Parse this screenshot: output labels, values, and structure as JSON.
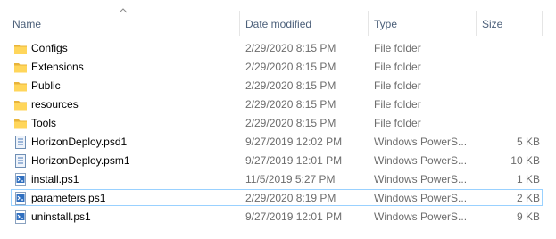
{
  "columns": {
    "name": "Name",
    "date_modified": "Date modified",
    "type": "Type",
    "size": "Size"
  },
  "sort": {
    "column": "name",
    "direction": "ascending",
    "icon": "sort-up-caret-icon"
  },
  "files": [
    {
      "name": "Configs",
      "date": "2/29/2020 8:15 PM",
      "type": "File folder",
      "size": "",
      "icon": "folder-icon",
      "selected": false
    },
    {
      "name": "Extensions",
      "date": "2/29/2020 8:15 PM",
      "type": "File folder",
      "size": "",
      "icon": "folder-icon",
      "selected": false
    },
    {
      "name": "Public",
      "date": "2/29/2020 8:15 PM",
      "type": "File folder",
      "size": "",
      "icon": "folder-icon",
      "selected": false
    },
    {
      "name": "resources",
      "date": "2/29/2020 8:15 PM",
      "type": "File folder",
      "size": "",
      "icon": "folder-icon",
      "selected": false
    },
    {
      "name": "Tools",
      "date": "2/29/2020 8:15 PM",
      "type": "File folder",
      "size": "",
      "icon": "folder-icon",
      "selected": false
    },
    {
      "name": "HorizonDeploy.psd1",
      "date": "9/27/2019 12:02 PM",
      "type": "Windows PowerS...",
      "size": "5 KB",
      "icon": "powershell-data-file-icon",
      "selected": false
    },
    {
      "name": "HorizonDeploy.psm1",
      "date": "9/27/2019 12:01 PM",
      "type": "Windows PowerS...",
      "size": "10 KB",
      "icon": "powershell-module-file-icon",
      "selected": false
    },
    {
      "name": "install.ps1",
      "date": "11/5/2019 5:27 PM",
      "type": "Windows PowerS...",
      "size": "1 KB",
      "icon": "powershell-script-icon",
      "selected": false
    },
    {
      "name": "parameters.ps1",
      "date": "2/29/2020 8:19 PM",
      "type": "Windows PowerS...",
      "size": "2 KB",
      "icon": "powershell-script-icon",
      "selected": true
    },
    {
      "name": "uninstall.ps1",
      "date": "9/27/2019 12:01 PM",
      "type": "Windows PowerS...",
      "size": "9 KB",
      "icon": "powershell-script-icon",
      "selected": false
    }
  ],
  "colors": {
    "header_text": "#4c607a",
    "folder_yellow": "#ffd65b",
    "folder_dark": "#e8b43a",
    "selection_border": "#99d1ff",
    "secondary_text": "#6d6d6d"
  }
}
